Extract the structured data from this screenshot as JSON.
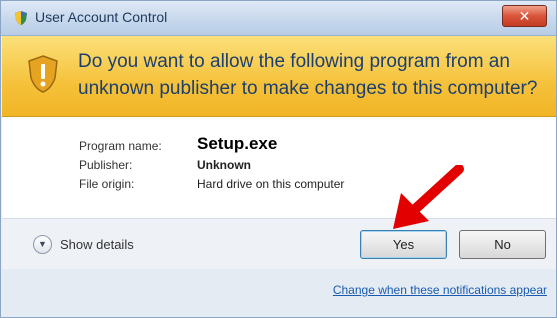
{
  "window": {
    "title": "User Account Control",
    "close_label": "✕"
  },
  "banner": {
    "message": "Do you want to allow the following program from an unknown publisher to make changes to this computer?"
  },
  "details": {
    "program_name_label": "Program name:",
    "program_name_value": "Setup.exe",
    "publisher_label": "Publisher:",
    "publisher_value": "Unknown",
    "file_origin_label": "File origin:",
    "file_origin_value": "Hard drive on this computer"
  },
  "actions": {
    "show_details_label": "Show details",
    "show_details_icon": "chevron-down-icon",
    "yes_label": "Yes",
    "no_label": "No"
  },
  "footer": {
    "link_label": "Change when these notifications appear"
  },
  "icons": {
    "title_icon": "uac-shield-icon",
    "banner_icon": "warning-shield-icon",
    "annotation": "red-arrow-icon"
  },
  "colors": {
    "banner": "#f5c13a",
    "banner_text": "#1d3f6e",
    "link": "#1a5bb0",
    "arrow": "#e30000"
  }
}
